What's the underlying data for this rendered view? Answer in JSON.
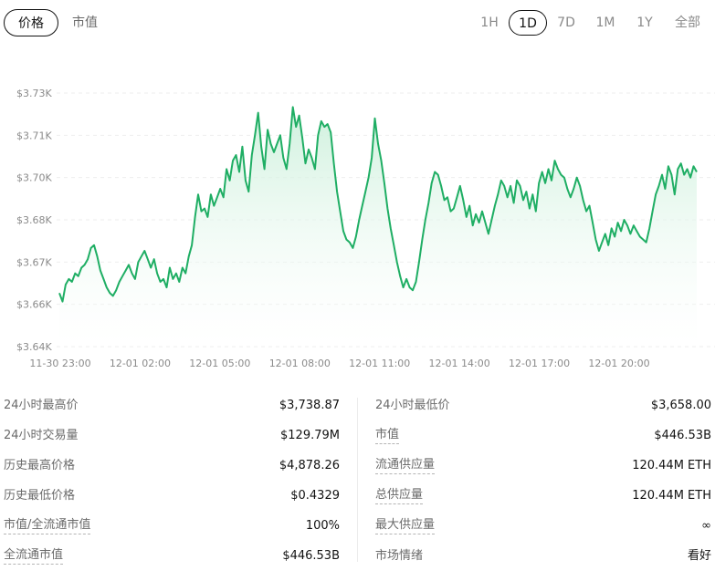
{
  "tabs": {
    "price_label": "价格",
    "marketcap_label": "市值"
  },
  "ranges": [
    "1H",
    "1D",
    "7D",
    "1M",
    "1Y",
    "全部"
  ],
  "active_range": "1D",
  "colors": {
    "line": "#1fae64",
    "fill_top": "#c9efd9",
    "fill_bottom": "#ffffff",
    "grid": "#eeeeee",
    "axis_text": "#8a8a8a"
  },
  "chart_data": {
    "type": "area",
    "title": "",
    "xlabel": "",
    "ylabel": "",
    "grid": "horizontal dashed",
    "y_ticks": [
      "$3.64K",
      "$3.66K",
      "$3.67K",
      "$3.68K",
      "$3.70K",
      "$3.71K",
      "$3.73K"
    ],
    "y_tick_values": [
      3640,
      3655,
      3670,
      3685,
      3700,
      3715,
      3730
    ],
    "ylim": [
      3640,
      3730
    ],
    "x_ticks": [
      "11-30 23:00",
      "12-01 02:00",
      "12-01 05:00",
      "12-01 08:00",
      "12-01 11:00",
      "12-01 14:00",
      "12-01 17:00",
      "12-01 20:00"
    ],
    "x_tick_hours": [
      0,
      3,
      6,
      9,
      12,
      15,
      18,
      21
    ],
    "xlim_hours": [
      -1.05,
      23.0
    ],
    "series": [
      {
        "points": [
          [
            -1.0,
            3659
          ],
          [
            -0.9,
            3656
          ],
          [
            -0.8,
            3662
          ],
          [
            -0.7,
            3664
          ],
          [
            -0.6,
            3663
          ],
          [
            -0.5,
            3666
          ],
          [
            -0.4,
            3665
          ],
          [
            -0.3,
            3668
          ],
          [
            -0.2,
            3669
          ],
          [
            -0.1,
            3671
          ],
          [
            0.0,
            3675
          ],
          [
            0.1,
            3676
          ],
          [
            0.2,
            3672
          ],
          [
            0.3,
            3667
          ],
          [
            0.4,
            3664
          ],
          [
            0.5,
            3661
          ],
          [
            0.6,
            3659
          ],
          [
            0.7,
            3658
          ],
          [
            0.8,
            3660
          ],
          [
            0.9,
            3663
          ],
          [
            1.0,
            3665
          ],
          [
            1.1,
            3667
          ],
          [
            1.2,
            3669
          ],
          [
            1.3,
            3666
          ],
          [
            1.4,
            3664
          ],
          [
            1.5,
            3670
          ],
          [
            1.6,
            3672
          ],
          [
            1.7,
            3674
          ],
          [
            1.8,
            3671
          ],
          [
            1.9,
            3668
          ],
          [
            2.0,
            3671
          ],
          [
            2.1,
            3666
          ],
          [
            2.2,
            3663
          ],
          [
            2.3,
            3664
          ],
          [
            2.4,
            3661
          ],
          [
            2.5,
            3668
          ],
          [
            2.6,
            3664
          ],
          [
            2.7,
            3666
          ],
          [
            2.8,
            3663
          ],
          [
            2.9,
            3668
          ],
          [
            3.0,
            3666
          ],
          [
            3.1,
            3672
          ],
          [
            3.2,
            3676
          ],
          [
            3.3,
            3686
          ],
          [
            3.4,
            3694
          ],
          [
            3.5,
            3688
          ],
          [
            3.6,
            3689
          ],
          [
            3.7,
            3686
          ],
          [
            3.8,
            3694
          ],
          [
            3.9,
            3690
          ],
          [
            4.0,
            3693
          ],
          [
            4.1,
            3696
          ],
          [
            4.2,
            3693
          ],
          [
            4.3,
            3703
          ],
          [
            4.4,
            3699
          ],
          [
            4.5,
            3706
          ],
          [
            4.6,
            3708
          ],
          [
            4.7,
            3702
          ],
          [
            4.8,
            3711
          ],
          [
            4.9,
            3699
          ],
          [
            5.0,
            3695
          ],
          [
            5.1,
            3708
          ],
          [
            5.2,
            3715
          ],
          [
            5.3,
            3723
          ],
          [
            5.4,
            3711
          ],
          [
            5.5,
            3703
          ],
          [
            5.6,
            3717
          ],
          [
            5.7,
            3712
          ],
          [
            5.8,
            3709
          ],
          [
            5.9,
            3712
          ],
          [
            6.0,
            3715
          ],
          [
            6.1,
            3707
          ],
          [
            6.2,
            3703
          ],
          [
            6.3,
            3712
          ],
          [
            6.4,
            3725
          ],
          [
            6.5,
            3718
          ],
          [
            6.6,
            3722
          ],
          [
            6.7,
            3714
          ],
          [
            6.8,
            3705
          ],
          [
            6.9,
            3710
          ],
          [
            7.0,
            3707
          ],
          [
            7.1,
            3703
          ],
          [
            7.2,
            3715
          ],
          [
            7.3,
            3720
          ],
          [
            7.4,
            3718
          ],
          [
            7.5,
            3719
          ],
          [
            7.6,
            3716
          ],
          [
            7.7,
            3705
          ],
          [
            7.8,
            3695
          ],
          [
            7.9,
            3688
          ],
          [
            8.0,
            3681
          ],
          [
            8.1,
            3678
          ],
          [
            8.2,
            3677
          ],
          [
            8.3,
            3675
          ],
          [
            8.4,
            3679
          ],
          [
            8.5,
            3685
          ],
          [
            8.6,
            3690
          ],
          [
            8.7,
            3695
          ],
          [
            8.8,
            3700
          ],
          [
            8.9,
            3707
          ],
          [
            9.0,
            3721
          ],
          [
            9.1,
            3712
          ],
          [
            9.2,
            3706
          ],
          [
            9.3,
            3698
          ],
          [
            9.4,
            3689
          ],
          [
            9.5,
            3682
          ],
          [
            9.6,
            3676
          ],
          [
            9.7,
            3670
          ],
          [
            9.8,
            3665
          ],
          [
            9.9,
            3661
          ],
          [
            10.0,
            3664
          ],
          [
            10.1,
            3661
          ],
          [
            10.2,
            3660
          ],
          [
            10.3,
            3663
          ],
          [
            10.4,
            3670
          ],
          [
            10.5,
            3678
          ],
          [
            10.6,
            3685
          ],
          [
            10.7,
            3691
          ],
          [
            10.8,
            3698
          ],
          [
            10.9,
            3702
          ],
          [
            11.0,
            3701
          ],
          [
            11.1,
            3697
          ],
          [
            11.2,
            3692
          ],
          [
            11.3,
            3693
          ],
          [
            11.4,
            3688
          ],
          [
            11.5,
            3689
          ],
          [
            11.6,
            3693
          ],
          [
            11.7,
            3697
          ],
          [
            11.8,
            3692
          ],
          [
            11.9,
            3686
          ],
          [
            12.0,
            3690
          ],
          [
            12.1,
            3683
          ],
          [
            12.2,
            3687
          ],
          [
            12.3,
            3684
          ],
          [
            12.4,
            3688
          ],
          [
            12.5,
            3684
          ],
          [
            12.6,
            3680
          ],
          [
            12.7,
            3685
          ],
          [
            12.8,
            3690
          ],
          [
            12.9,
            3694
          ],
          [
            13.0,
            3699
          ],
          [
            13.1,
            3697
          ],
          [
            13.2,
            3693
          ],
          [
            13.3,
            3697
          ],
          [
            13.4,
            3691
          ],
          [
            13.5,
            3699
          ],
          [
            13.6,
            3697
          ],
          [
            13.7,
            3692
          ],
          [
            13.8,
            3695
          ],
          [
            13.9,
            3689
          ],
          [
            14.0,
            3694
          ],
          [
            14.1,
            3688
          ],
          [
            14.2,
            3698
          ],
          [
            14.3,
            3702
          ],
          [
            14.4,
            3698
          ],
          [
            14.5,
            3703
          ],
          [
            14.6,
            3699
          ],
          [
            14.7,
            3706
          ],
          [
            14.8,
            3703
          ],
          [
            14.9,
            3701
          ],
          [
            15.0,
            3700
          ],
          [
            15.1,
            3696
          ],
          [
            15.2,
            3693
          ],
          [
            15.3,
            3696
          ],
          [
            15.4,
            3700
          ],
          [
            15.5,
            3697
          ],
          [
            15.6,
            3692
          ],
          [
            15.7,
            3688
          ],
          [
            15.8,
            3690
          ],
          [
            15.9,
            3684
          ],
          [
            16.0,
            3678
          ],
          [
            16.1,
            3674
          ],
          [
            16.2,
            3677
          ],
          [
            16.3,
            3680
          ],
          [
            16.4,
            3676
          ],
          [
            16.5,
            3682
          ],
          [
            16.6,
            3679
          ],
          [
            16.7,
            3684
          ],
          [
            16.8,
            3681
          ],
          [
            16.9,
            3685
          ],
          [
            17.0,
            3683
          ],
          [
            17.1,
            3680
          ],
          [
            17.2,
            3683
          ],
          [
            17.3,
            3681
          ],
          [
            17.4,
            3679
          ],
          [
            17.5,
            3678
          ],
          [
            17.6,
            3677
          ],
          [
            17.7,
            3682
          ],
          [
            17.8,
            3688
          ],
          [
            17.9,
            3694
          ],
          [
            18.0,
            3697
          ],
          [
            18.1,
            3701
          ],
          [
            18.2,
            3696
          ],
          [
            18.3,
            3704
          ],
          [
            18.4,
            3701
          ],
          [
            18.5,
            3694
          ],
          [
            18.6,
            3703
          ],
          [
            18.7,
            3705
          ],
          [
            18.8,
            3701
          ],
          [
            18.9,
            3703
          ],
          [
            19.0,
            3700
          ],
          [
            19.1,
            3704
          ],
          [
            19.2,
            3702
          ]
        ]
      }
    ],
    "plot_hours_map": {
      "hour0": -1.0
    }
  },
  "stats": {
    "left": [
      {
        "label": "24小时最高价",
        "value": "$3,738.87",
        "dotted": false
      },
      {
        "label": "24小时交易量",
        "value": "$129.79M",
        "dotted": false
      },
      {
        "label": "历史最高价格",
        "value": "$4,878.26",
        "dotted": false
      },
      {
        "label": "历史最低价格",
        "value": "$0.4329",
        "dotted": false
      },
      {
        "label": "市值/全流通市值",
        "value": "100%",
        "dotted": true
      },
      {
        "label": "全流通市值",
        "value": "$446.53B",
        "dotted": true
      }
    ],
    "right": [
      {
        "label": "24小时最低价",
        "value": "$3,658.00",
        "dotted": false
      },
      {
        "label": "市值",
        "value": "$446.53B",
        "dotted": true
      },
      {
        "label": "流通供应量",
        "value": "120.44M ETH",
        "dotted": true
      },
      {
        "label": "总供应量",
        "value": "120.44M ETH",
        "dotted": true
      },
      {
        "label": "最大供应量",
        "value": "∞",
        "dotted": true
      },
      {
        "label": "市场情绪",
        "value": "看好",
        "dotted": false
      }
    ]
  }
}
